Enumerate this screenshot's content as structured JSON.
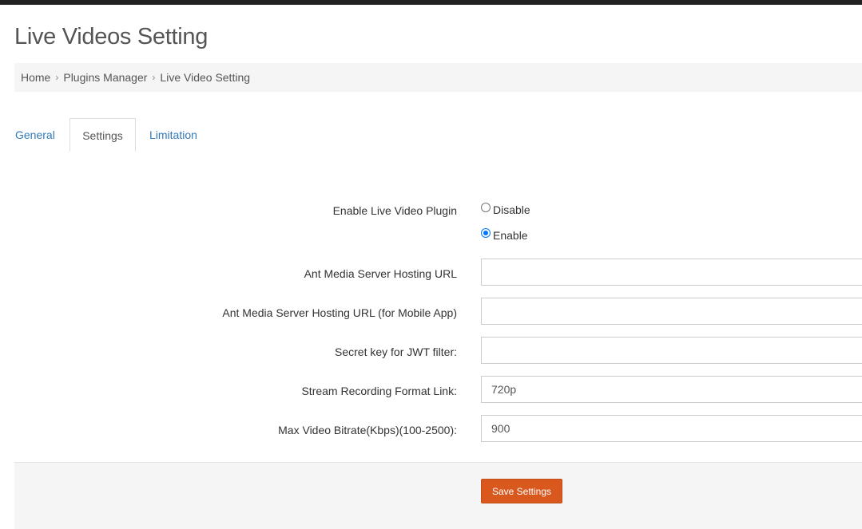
{
  "page": {
    "title": "Live Videos Setting"
  },
  "breadcrumb": {
    "items": [
      "Home",
      "Plugins Manager",
      "Live Video Setting"
    ]
  },
  "tabs": [
    {
      "label": "General"
    },
    {
      "label": "Settings"
    },
    {
      "label": "Limitation"
    }
  ],
  "form": {
    "enable_plugin": {
      "label": "Enable Live Video Plugin",
      "options": [
        "Disable",
        "Enable"
      ],
      "selected": "Enable"
    },
    "ams_url": {
      "label": "Ant Media Server Hosting URL",
      "value": ""
    },
    "ams_url_mobile": {
      "label": "Ant Media Server Hosting URL (for Mobile App)",
      "value": ""
    },
    "jwt_secret": {
      "label": "Secret key for JWT filter:",
      "value": ""
    },
    "recording_format": {
      "label": "Stream Recording Format Link:",
      "value": "720p"
    },
    "max_bitrate": {
      "label": "Max Video Bitrate(Kbps)(100-2500):",
      "value": "900"
    }
  },
  "footer": {
    "save_label": "Save Settings"
  },
  "colors": {
    "accent": "#d9581e",
    "link": "#337ab7",
    "radio": "#0075ff"
  }
}
